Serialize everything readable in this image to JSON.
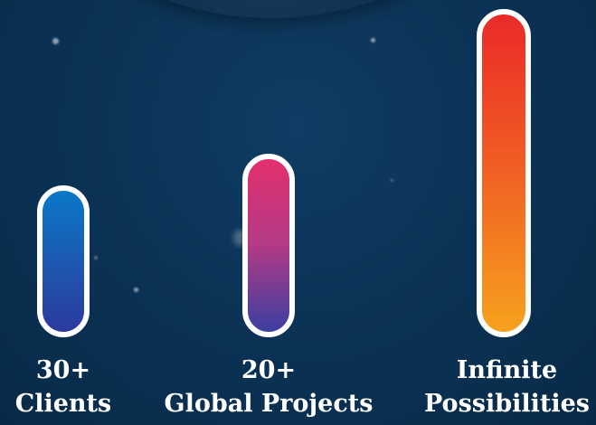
{
  "stats": [
    {
      "value": "30+",
      "label": "Clients",
      "level": 0.37
    },
    {
      "value": "20+",
      "label": "Global Projects",
      "level": 0.45
    },
    {
      "value": "Infinite",
      "label": "Possibilities",
      "level": 1.0
    }
  ],
  "colors": {
    "background": "#0b3356",
    "clients_gradient": [
      "#0a78c8",
      "#2c3a9e"
    ],
    "global_gradient": [
      "#e2306e",
      "#3a3fa0"
    ],
    "infinite_gradient": [
      "#ea2a28",
      "#f7a21e"
    ]
  }
}
